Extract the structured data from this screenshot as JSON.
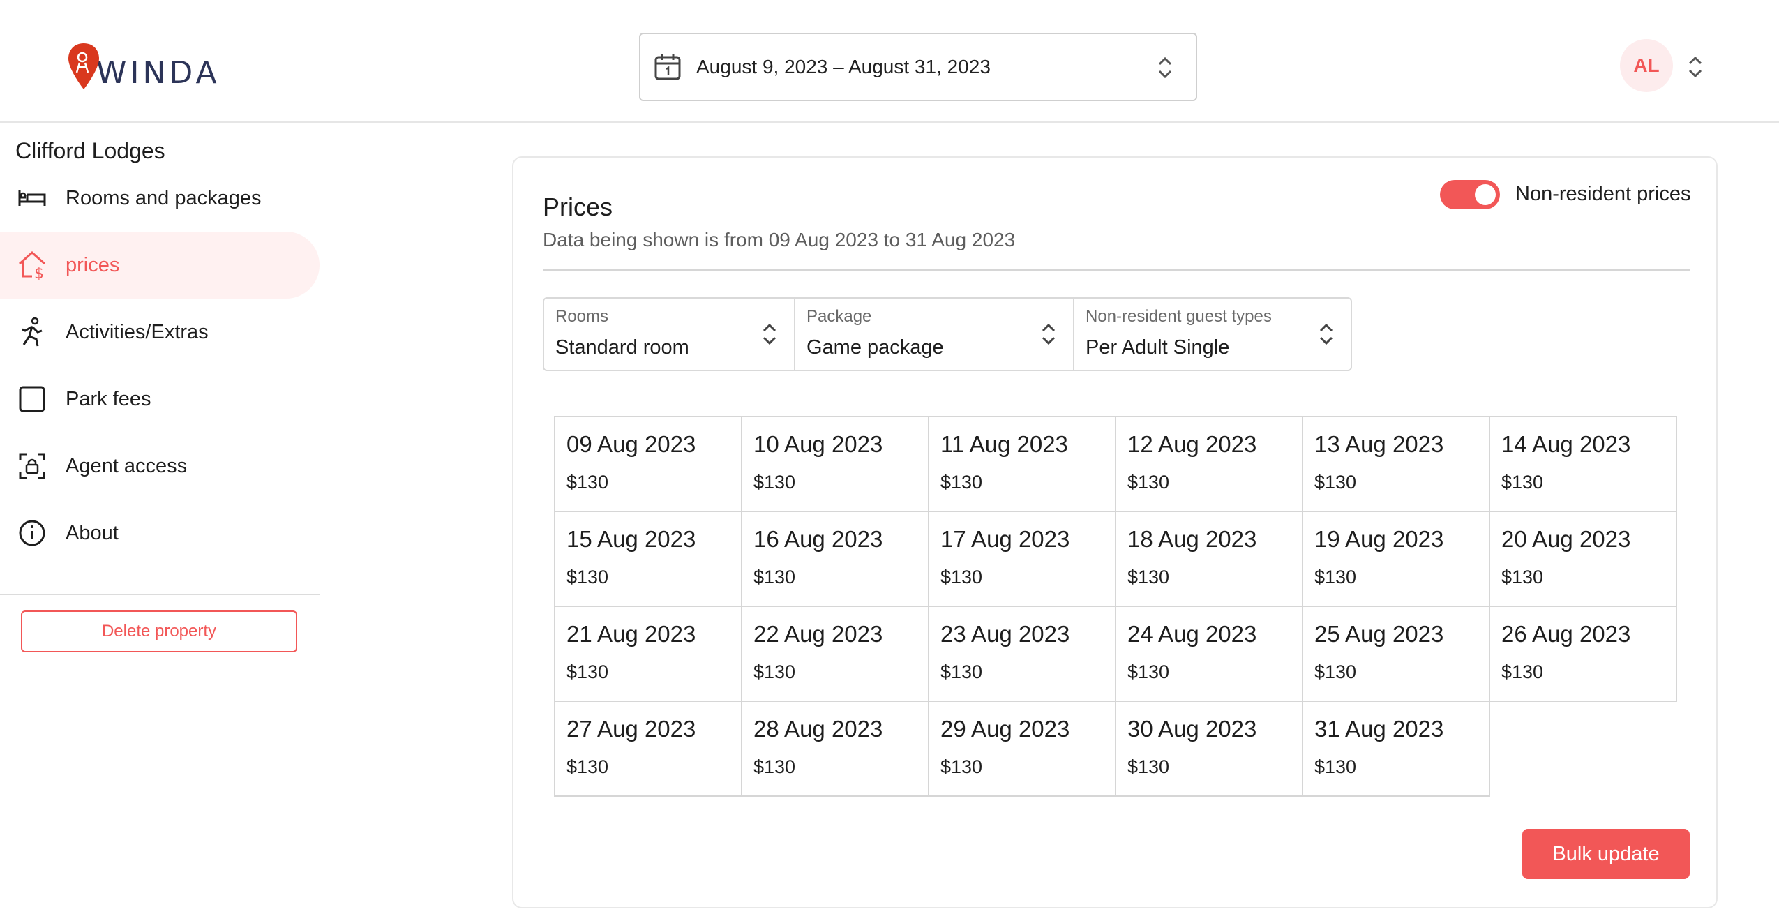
{
  "header": {
    "brand": "WINDA",
    "date_range": "August 9, 2023 – August 31, 2023",
    "user_initials": "AL"
  },
  "sidebar": {
    "property_name": "Clifford Lodges",
    "items": [
      {
        "label": "Rooms and packages",
        "icon": "bed-icon",
        "active": false
      },
      {
        "label": "prices",
        "icon": "house-dollar-icon",
        "active": true
      },
      {
        "label": "Activities/Extras",
        "icon": "running-person-icon",
        "active": false
      },
      {
        "label": "Park fees",
        "icon": "square-icon",
        "active": false
      },
      {
        "label": "Agent access",
        "icon": "scan-lock-icon",
        "active": false
      },
      {
        "label": "About",
        "icon": "info-icon",
        "active": false
      }
    ],
    "delete_label": "Delete property"
  },
  "main": {
    "title": "Prices",
    "subtitle": "Data being shown is from 09 Aug 2023 to 31 Aug 2023",
    "toggle_label": "Non-resident prices",
    "toggle_on": true,
    "filters": [
      {
        "label": "Rooms",
        "value": "Standard room"
      },
      {
        "label": "Package",
        "value": "Game package"
      },
      {
        "label": "Non-resident guest types",
        "value": "Per Adult Single"
      }
    ],
    "prices": [
      {
        "date": "09 Aug 2023",
        "price": "$130"
      },
      {
        "date": "10 Aug 2023",
        "price": "$130"
      },
      {
        "date": "11 Aug 2023",
        "price": "$130"
      },
      {
        "date": "12 Aug 2023",
        "price": "$130"
      },
      {
        "date": "13 Aug 2023",
        "price": "$130"
      },
      {
        "date": "14 Aug 2023",
        "price": "$130"
      },
      {
        "date": "15 Aug 2023",
        "price": "$130"
      },
      {
        "date": "16 Aug 2023",
        "price": "$130"
      },
      {
        "date": "17 Aug 2023",
        "price": "$130"
      },
      {
        "date": "18 Aug 2023",
        "price": "$130"
      },
      {
        "date": "19 Aug 2023",
        "price": "$130"
      },
      {
        "date": "20 Aug 2023",
        "price": "$130"
      },
      {
        "date": "21 Aug 2023",
        "price": "$130"
      },
      {
        "date": "22 Aug 2023",
        "price": "$130"
      },
      {
        "date": "23 Aug 2023",
        "price": "$130"
      },
      {
        "date": "24 Aug 2023",
        "price": "$130"
      },
      {
        "date": "25 Aug 2023",
        "price": "$130"
      },
      {
        "date": "26 Aug 2023",
        "price": "$130"
      },
      {
        "date": "27 Aug 2023",
        "price": "$130"
      },
      {
        "date": "28 Aug 2023",
        "price": "$130"
      },
      {
        "date": "29 Aug 2023",
        "price": "$130"
      },
      {
        "date": "30 Aug 2023",
        "price": "$130"
      },
      {
        "date": "31 Aug 2023",
        "price": "$130"
      }
    ],
    "bulk_label": "Bulk update"
  },
  "colors": {
    "accent": "#f25757",
    "accent_bg": "#fff1f1",
    "brand_text": "#2c3458"
  }
}
